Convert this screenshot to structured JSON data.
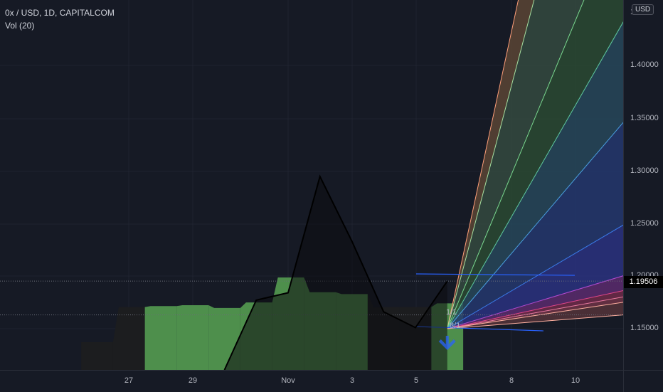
{
  "header": {
    "title": "0x / USD, 1D, CAPITALCOM",
    "indicator": "Vol (20)"
  },
  "axis": {
    "currency": "USD",
    "price_badge": "1.19506",
    "y_top_tick": "1",
    "y_ticks": [
      "1.40000",
      "1.35000",
      "1.30000",
      "1.25000",
      "1.20000",
      "1.15000"
    ]
  },
  "chart_data": {
    "type": "area",
    "x_ticks": [
      "27",
      "29",
      "Nov",
      "3",
      "5",
      "8",
      "10"
    ],
    "y_range": [
      1.11,
      1.45
    ],
    "price_line": {
      "points": [
        {
          "x": "Oct 29",
          "y": 1.11
        },
        {
          "x": "Oct 30",
          "y": 1.177
        },
        {
          "x": "Oct 31",
          "y": 1.184
        },
        {
          "x": "Nov 1",
          "y": 1.294
        },
        {
          "x": "Nov 2",
          "y": 1.233
        },
        {
          "x": "Nov 3",
          "y": 1.166
        },
        {
          "x": "Nov 4",
          "y": 1.151
        },
        {
          "x": "Nov 5",
          "y": 1.195
        }
      ]
    },
    "volume": {
      "bars": [
        {
          "x": "Oct 25",
          "v": 0.3,
          "up": false
        },
        {
          "x": "Oct 26",
          "v": 0.68,
          "up": false
        },
        {
          "x": "Oct 27",
          "v": 0.69,
          "up": true
        },
        {
          "x": "Oct 28",
          "v": 0.7,
          "up": true
        },
        {
          "x": "Oct 29",
          "v": 0.67,
          "up": true
        },
        {
          "x": "Oct 30",
          "v": 0.73,
          "up": true
        },
        {
          "x": "Oct 31",
          "v": 1.0,
          "up": true
        },
        {
          "x": "Nov 1",
          "v": 0.84,
          "up": true
        },
        {
          "x": "Nov 2",
          "v": 0.82,
          "up": true
        },
        {
          "x": "Nov 3",
          "v": 0.68,
          "up": false
        },
        {
          "x": "Nov 4",
          "v": 0.68,
          "up": false
        },
        {
          "x": "Nov 5",
          "v": 0.72,
          "up": true
        }
      ]
    },
    "gann_fan": {
      "labels": [
        "1/1",
        "8/1"
      ],
      "rays_end_price": [
        1.92,
        1.78,
        1.55,
        1.44,
        1.345,
        1.248,
        1.2,
        1.186,
        1.18,
        1.175,
        1.163
      ]
    },
    "markers": [
      {
        "type": "down-arrow",
        "x": "Nov 5",
        "color": "#2962ff"
      }
    ],
    "reference_lines": [
      {
        "price": 1.195,
        "style": "dotted"
      },
      {
        "price": 1.163,
        "style": "dotted"
      }
    ],
    "colors": {
      "volume_up": "#4e8f4c",
      "volume_down": "#1c1e1f",
      "price_line": "#000000",
      "fan": [
        "#ff9f7a",
        "#a6e0a0",
        "#7ad98f",
        "#5ec8a0",
        "#4aa0e0",
        "#3a7ae8",
        "#b04ad0",
        "#e0468a",
        "#e87aa0",
        "#ffb0a0"
      ]
    }
  }
}
